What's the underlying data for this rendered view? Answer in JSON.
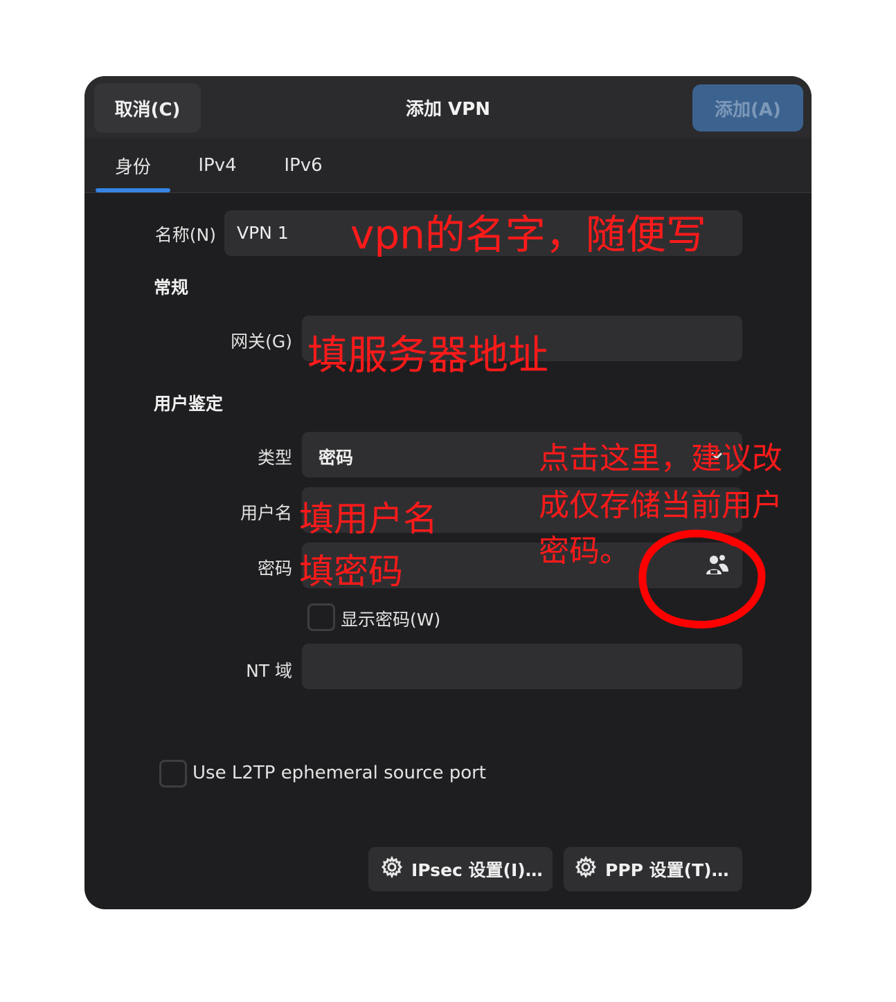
{
  "header": {
    "cancel_label": "取消(C)",
    "title": "添加 VPN",
    "add_label": "添加(A)"
  },
  "tabs": [
    {
      "label": "身份",
      "active": true
    },
    {
      "label": "IPv4",
      "active": false
    },
    {
      "label": "IPv6",
      "active": false
    }
  ],
  "form": {
    "name_label": "名称(N)",
    "name_value": "VPN 1",
    "general_section": "常规",
    "gateway_label": "网关(G)",
    "gateway_value": "",
    "auth_section": "用户鉴定",
    "type_label": "类型",
    "type_value": "密码",
    "username_label": "用户名",
    "username_value": "",
    "password_label": "密码",
    "password_value": "",
    "show_password_label": "显示密码(W)",
    "show_password_checked": false,
    "nt_domain_label": "NT 域",
    "nt_domain_value": "",
    "l2tp_label": "Use L2TP ephemeral source port",
    "l2tp_checked": false
  },
  "footer": {
    "ipsec_label": "IPsec 设置(I)…",
    "ppp_label": "PPP 设置(T)…"
  },
  "annotations": {
    "name_note": "vpn的名字，随便写",
    "gateway_note": "填服务器地址",
    "type_note_line1": "点击这里，建议改",
    "type_note_line2": "成仅存储当前用户",
    "type_note_line3": "密码。",
    "username_note": "填用户名",
    "password_note": "填密码",
    "color": "#ff1a1a"
  },
  "colors": {
    "dialog_bg": "#1e1e20",
    "header_bg": "#2b2b2e",
    "field_bg": "#2f2f32",
    "accent": "#3584e4",
    "add_button_bg": "#3c6390"
  }
}
